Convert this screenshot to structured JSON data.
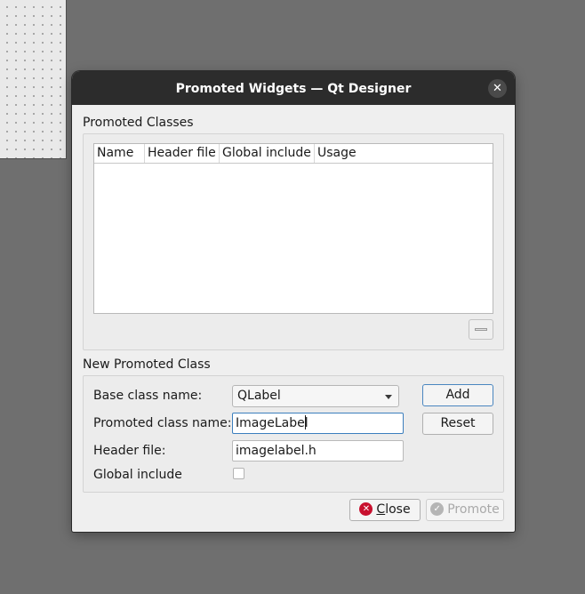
{
  "window": {
    "title": "Promoted Widgets — Qt Designer",
    "close_glyph": "✕"
  },
  "promoted_classes": {
    "group_label": "Promoted Classes",
    "columns": [
      "Name",
      "Header file",
      "Global include",
      "Usage"
    ],
    "rows": [],
    "remove_button_icon": "minus-icon"
  },
  "new_class": {
    "group_label": "New Promoted Class",
    "base_class_label": "Base class name:",
    "base_class_value": "QLabel",
    "promoted_class_label": "Promoted class name:",
    "promoted_class_value": "ImageLabel",
    "header_file_label": "Header file:",
    "header_file_value": "imagelabel.h",
    "global_include_label": "Global include",
    "global_include_checked": false,
    "add_label": "Add",
    "reset_label": "Reset"
  },
  "footer": {
    "close_label": "Close",
    "close_mnemonic": "C",
    "close_rest": "lose",
    "promote_label": "Promote",
    "close_icon": "close-circle-icon",
    "promote_icon": "check-circle-icon"
  },
  "colors": {
    "titlebar": "#2c2c2c",
    "dialog_bg": "#efefef",
    "focus_border": "#3c7fbe",
    "close_icon_red": "#c8102e"
  }
}
